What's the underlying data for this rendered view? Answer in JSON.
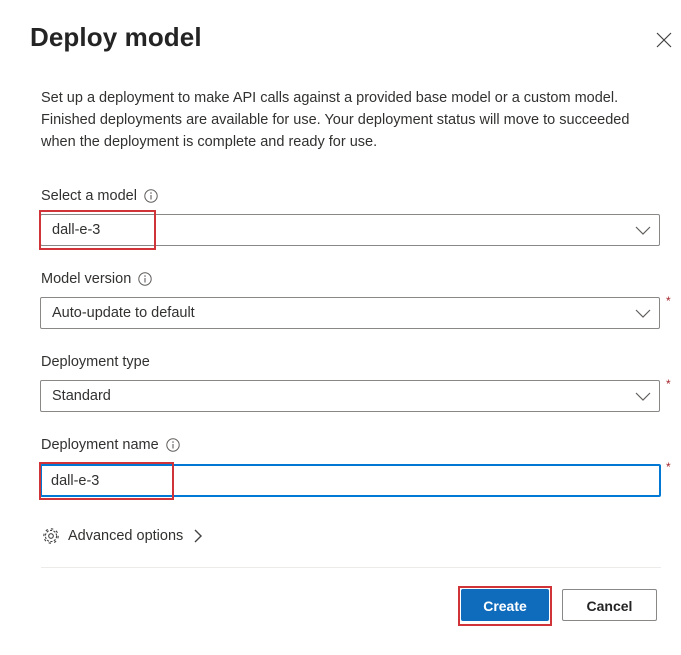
{
  "dialog": {
    "title": "Deploy model",
    "description": "Set up a deployment to make API calls against a provided base model or a custom model. Finished deployments are available for use. Your deployment status will move to succeeded when the deployment is complete and ready for use."
  },
  "fields": {
    "model": {
      "label": "Select a model",
      "value": "dall-e-3",
      "info_icon": "info-icon",
      "icon": "chevron-down-icon"
    },
    "model_version": {
      "label": "Model version",
      "value": "Auto-update to default",
      "required_marker": "*",
      "info_icon": "info-icon"
    },
    "deployment_type": {
      "label": "Deployment type",
      "value": "Standard",
      "required_marker": "*"
    },
    "deployment_name": {
      "label": "Deployment name",
      "value": "dall-e-3",
      "required_marker": "*",
      "info_icon": "info-icon"
    }
  },
  "advanced": {
    "label": "Advanced options",
    "icon": "gear-icon",
    "chevron": "chevron-right-icon"
  },
  "actions": {
    "create_label": "Create",
    "cancel_label": "Cancel"
  },
  "colors": {
    "primary": "#0f6cbd",
    "highlight": "#d13438",
    "required": "#a4262c",
    "focus_border": "#0078d4"
  }
}
